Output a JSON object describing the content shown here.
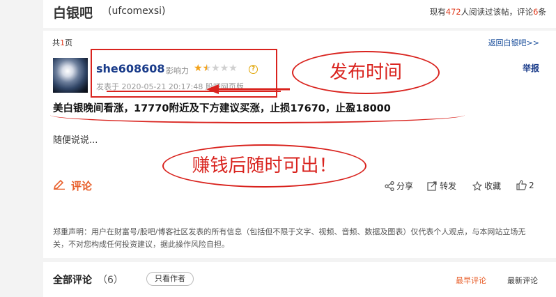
{
  "header": {
    "forum_name": "白银吧",
    "forum_code": "(ufcomexsi)",
    "read_prefix": "现有",
    "read_count": "472",
    "read_mid": "人阅读过该帖，评论",
    "comment_count": "6",
    "read_suffix": "条"
  },
  "pager": {
    "prefix": "共",
    "total": "1",
    "suffix": "页"
  },
  "back_link": "返回白银吧>>",
  "post": {
    "author": "she608608",
    "influence_label": "影响力",
    "stars": {
      "filled": 1.5,
      "total": 5
    },
    "help": "?",
    "report": "举报",
    "time": "发表于 2020-05-21 20:17:48 股吧网页版",
    "title": "美白银晚间看涨，17770附近及下方建议买涨，止损17670，止盈18000",
    "body": "随便说说..."
  },
  "annotations": {
    "publish_time": "发布时间",
    "take_profit": "赚钱后随时可出！"
  },
  "actions": {
    "comment": "评论",
    "share": "分享",
    "forward": "转发",
    "favorite": "收藏",
    "like_count": "2"
  },
  "disclaimer": "郑重声明：用户在财富号/股吧/博客社区发表的所有信息（包括但不限于文字、视频、音频、数据及图表）仅代表个人观点，与本网站立场无关，不对您构成任何投资建议，据此操作风险自担。",
  "comments": {
    "label": "全部评论",
    "count": "（6）",
    "only_author": "只看作者",
    "sort_earliest": "最早评论",
    "sort_latest": "最新评论"
  },
  "colors": {
    "accent": "#e8602c",
    "annotation": "#d9231e",
    "link": "#1a3c8a"
  }
}
